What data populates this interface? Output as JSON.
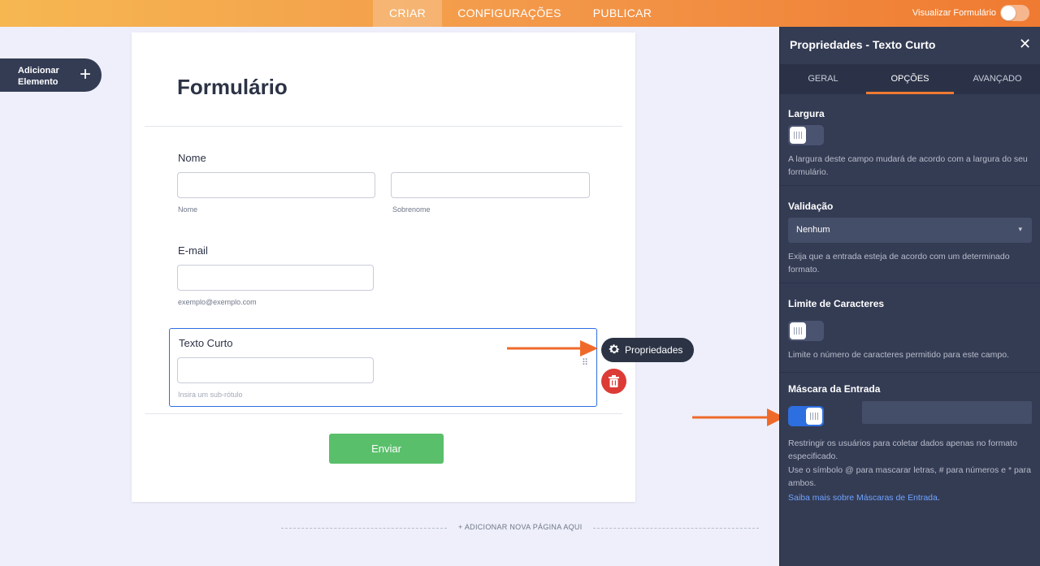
{
  "topbar": {
    "tabs": [
      {
        "label": "CRIAR",
        "active": true
      },
      {
        "label": "CONFIGURAÇÕES",
        "active": false
      },
      {
        "label": "PUBLICAR",
        "active": false
      }
    ],
    "preview_label": "Visualizar Formulário",
    "gradient": [
      "#f6b751",
      "#ef7a31"
    ]
  },
  "add_element": {
    "label_line1": "Adicionar",
    "label_line2": "Elemento",
    "icon": "plus-icon"
  },
  "form": {
    "title": "Formulário",
    "name_field": {
      "label": "Nome",
      "first_sublabel": "Nome",
      "last_sublabel": "Sobrenome",
      "first_value": "",
      "last_value": ""
    },
    "email_field": {
      "label": "E-mail",
      "sublabel": "exemplo@exemplo.com",
      "value": ""
    },
    "short_text_field": {
      "label": "Texto Curto",
      "sublabel_placeholder": "Insira um sub-rótulo",
      "value": ""
    },
    "submit_label": "Enviar",
    "properties_button": "Propriedades",
    "add_page": "+ ADICIONAR NOVA PÁGINA AQUI"
  },
  "panel": {
    "title": "Propriedades - Texto Curto",
    "tabs": [
      {
        "label": "GERAL",
        "active": false
      },
      {
        "label": "OPÇÕES",
        "active": true
      },
      {
        "label": "AVANÇADO",
        "active": false
      }
    ],
    "width": {
      "title": "Largura",
      "on": false,
      "help": "A largura deste campo mudará de acordo com a largura do seu formulário."
    },
    "validation": {
      "title": "Validação",
      "value": "Nenhum",
      "help": "Exija que a entrada esteja de acordo com um determinado formato."
    },
    "char_limit": {
      "title": "Limite de Caracteres",
      "on": false,
      "help": "Limite o número de caracteres permitido para este campo."
    },
    "input_mask": {
      "title": "Máscara da Entrada",
      "on": true,
      "value": "",
      "help1": "Restringir os usuários para coletar dados apenas no formato especificado.",
      "help2": "Use o símbolo @ para mascarar letras, # para números e * para ambos.",
      "link": "Saiba mais sobre Máscaras de Entrada",
      "link_suffix": "."
    }
  },
  "colors": {
    "accent": "#ef7a31",
    "selection": "#2d6ee0",
    "submit": "#5abf6b",
    "delete": "#dc3b36",
    "panel": "#343c54"
  }
}
